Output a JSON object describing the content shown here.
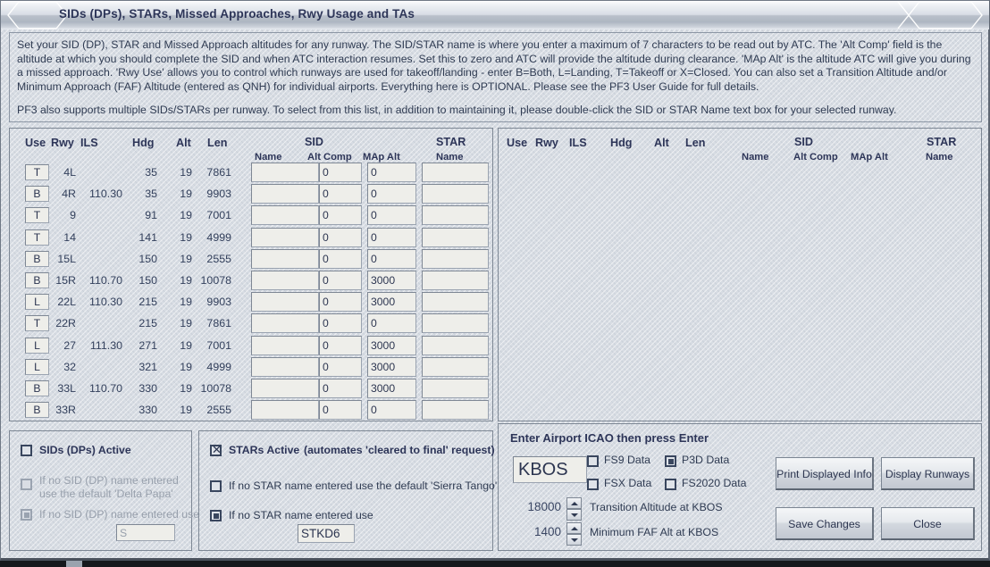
{
  "window": {
    "title": "SIDs (DPs), STARs, Missed Approaches, Rwy Usage and TAs"
  },
  "instructions": {
    "para1": "Set your SID (DP), STAR and Missed Approach altitudes for any runway. The SID/STAR name is where you enter a maximum of 7 characters to be read out by ATC. The 'Alt Comp' field is the altitude at which you should complete the SID and when ATC interaction resumes. Set this to zero and ATC will provide the altitude during clearance. 'MAp Alt' is the altitude ATC will give you during a missed approach. 'Rwy Use' allows you to control which runways are used for takeoff/landing - enter B=Both, L=Landing, T=Takeoff or X=Closed.  You can also set a Transition Altitude and/or Minimum Approach (FAF) Altitude (entered as QNH) for individual airports. Everything here is OPTIONAL. Please see the PF3 User Guide for full details.",
    "para2": "PF3 also supports multiple SIDs/STARs per runway. To select from this list, in addition to maintaining it, please double-click the SID or STAR Name text box for your selected runway."
  },
  "table": {
    "headers": {
      "use": "Use",
      "rwy": "Rwy",
      "ils": "ILS",
      "hdg": "Hdg",
      "alt": "Alt",
      "len": "Len",
      "sid_group": "SID",
      "star_group": "STAR",
      "name": "Name",
      "alt_comp": "Alt Comp",
      "map_alt": "MAp Alt",
      "star_name": "Name"
    },
    "rows": [
      {
        "use": "T",
        "rwy": "4L",
        "ils": "",
        "hdg": "35",
        "alt": "19",
        "len": "7861",
        "sid_name": "",
        "alt_comp": "0",
        "map_alt": "0",
        "star_name": ""
      },
      {
        "use": "B",
        "rwy": "4R",
        "ils": "110.30",
        "hdg": "35",
        "alt": "19",
        "len": "9903",
        "sid_name": "",
        "alt_comp": "0",
        "map_alt": "0",
        "star_name": ""
      },
      {
        "use": "T",
        "rwy": "9",
        "ils": "",
        "hdg": "91",
        "alt": "19",
        "len": "7001",
        "sid_name": "",
        "alt_comp": "0",
        "map_alt": "0",
        "star_name": ""
      },
      {
        "use": "T",
        "rwy": "14",
        "ils": "",
        "hdg": "141",
        "alt": "19",
        "len": "4999",
        "sid_name": "",
        "alt_comp": "0",
        "map_alt": "0",
        "star_name": ""
      },
      {
        "use": "B",
        "rwy": "15L",
        "ils": "",
        "hdg": "150",
        "alt": "19",
        "len": "2555",
        "sid_name": "",
        "alt_comp": "0",
        "map_alt": "0",
        "star_name": ""
      },
      {
        "use": "B",
        "rwy": "15R",
        "ils": "110.70",
        "hdg": "150",
        "alt": "19",
        "len": "10078",
        "sid_name": "",
        "alt_comp": "0",
        "map_alt": "3000",
        "star_name": ""
      },
      {
        "use": "L",
        "rwy": "22L",
        "ils": "110.30",
        "hdg": "215",
        "alt": "19",
        "len": "9903",
        "sid_name": "",
        "alt_comp": "0",
        "map_alt": "3000",
        "star_name": ""
      },
      {
        "use": "T",
        "rwy": "22R",
        "ils": "",
        "hdg": "215",
        "alt": "19",
        "len": "7861",
        "sid_name": "",
        "alt_comp": "0",
        "map_alt": "0",
        "star_name": ""
      },
      {
        "use": "L",
        "rwy": "27",
        "ils": "111.30",
        "hdg": "271",
        "alt": "19",
        "len": "7001",
        "sid_name": "",
        "alt_comp": "0",
        "map_alt": "3000",
        "star_name": ""
      },
      {
        "use": "L",
        "rwy": "32",
        "ils": "",
        "hdg": "321",
        "alt": "19",
        "len": "4999",
        "sid_name": "",
        "alt_comp": "0",
        "map_alt": "3000",
        "star_name": ""
      },
      {
        "use": "B",
        "rwy": "33L",
        "ils": "110.70",
        "hdg": "330",
        "alt": "19",
        "len": "10078",
        "sid_name": "",
        "alt_comp": "0",
        "map_alt": "3000",
        "star_name": ""
      },
      {
        "use": "B",
        "rwy": "33R",
        "ils": "",
        "hdg": "330",
        "alt": "19",
        "len": "2555",
        "sid_name": "",
        "alt_comp": "0",
        "map_alt": "0",
        "star_name": ""
      }
    ]
  },
  "sid_panel": {
    "active_label": "SIDs (DPs) Active",
    "active_checked": false,
    "default_label_line1": "If no SID (DP) name entered",
    "default_label_line2": "use the default 'Delta Papa'",
    "default_checked": false,
    "custom_label": "If no SID (DP) name entered use",
    "custom_checked": true,
    "custom_value": "S"
  },
  "star_panel": {
    "active_label": "STARs Active",
    "active_note": "(automates 'cleared to final' request)",
    "active_checked": true,
    "default_label": "If no STAR name entered use the default 'Sierra Tango'",
    "default_checked": false,
    "custom_label": "If no STAR name entered use",
    "custom_checked": true,
    "custom_value": "STKD6"
  },
  "icao_panel": {
    "title": "Enter Airport ICAO then press Enter",
    "icao_value": "KBOS",
    "sim_options": [
      {
        "label": "FS9 Data",
        "selected": false
      },
      {
        "label": "P3D Data",
        "selected": true
      },
      {
        "label": "FSX Data",
        "selected": false
      },
      {
        "label": "FS2020 Data",
        "selected": false
      }
    ],
    "transition_alt_value": "18000",
    "transition_alt_label": "Transition Altitude at KBOS",
    "faf_alt_value": "1400",
    "faf_alt_label": "Minimum FAF Alt at KBOS",
    "buttons": {
      "print": "Print Displayed Info",
      "display_runways": "Display Runways",
      "save": "Save Changes",
      "close": "Close"
    }
  }
}
